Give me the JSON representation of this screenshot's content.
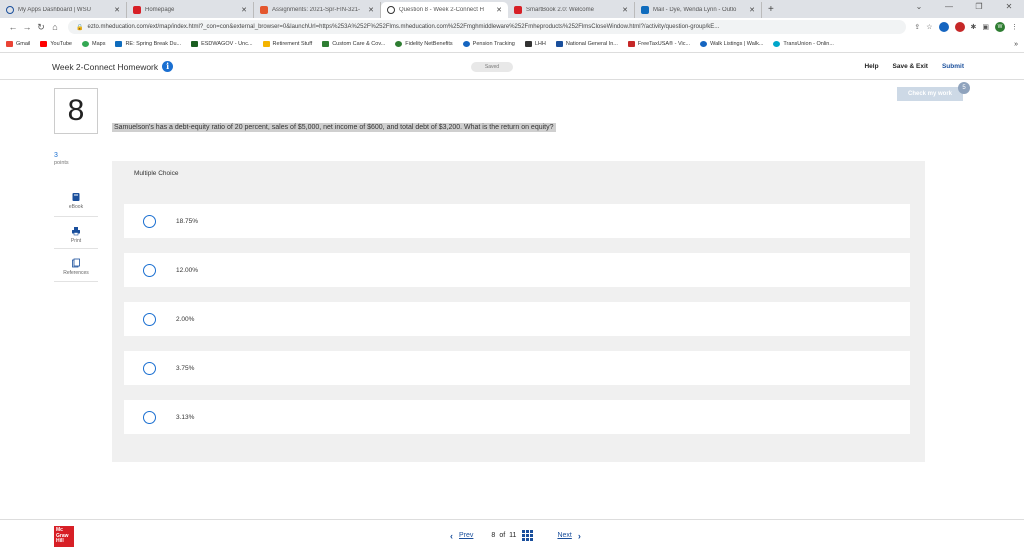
{
  "browser": {
    "tabs": [
      {
        "title": "My Apps Dashboard | WSU",
        "color": "#ffffff",
        "active": false
      },
      {
        "title": "Homepage",
        "color": "#d71f26",
        "active": false
      },
      {
        "title": "Assignments: 2021-Spr-FIN-321-",
        "color": "#e4572e",
        "active": false
      },
      {
        "title": "Question 8 - Week 2-Connect H",
        "color": "#333333",
        "active": true
      },
      {
        "title": "SmartBook 2.0: Welcome",
        "color": "#d71f26",
        "active": false
      },
      {
        "title": "Mail - Dye, Wenda Lynn - Outlo",
        "color": "#0f6cbd",
        "active": false
      }
    ],
    "new_tab": "+",
    "url": "ezto.mheducation.com/ext/map/index.html?_con=con&external_browser=0&launchUrl=https%253A%252F%252Flms.mheducation.com%252Fmghmiddleware%252Fmheproducts%252FlmsCloseWindow.html?/activity/question-group/kE...",
    "bookmarks": [
      {
        "label": "Gmail",
        "color": "#ea4335"
      },
      {
        "label": "YouTube",
        "color": "#ff0000"
      },
      {
        "label": "Maps",
        "color": "#34a853"
      },
      {
        "label": "RE: Spring Break Du...",
        "color": "#0f6cbd"
      },
      {
        "label": "ESDWAGOV - Unc...",
        "color": "#1b5e20"
      },
      {
        "label": "Retirement Stuff",
        "color": "#f4b400"
      },
      {
        "label": "Custom Care & Cov...",
        "color": "#2e7d32"
      },
      {
        "label": "Fidelity NetBenefits",
        "color": "#2e7d32"
      },
      {
        "label": "Pension Tracking",
        "color": "#1565c0"
      },
      {
        "label": "LHH",
        "color": "#333333"
      },
      {
        "label": "National General In...",
        "color": "#1a4f9c"
      },
      {
        "label": "FreeTaxUSA® - Vic...",
        "color": "#c62828"
      },
      {
        "label": "Walk Listings | Walk...",
        "color": "#1565c0"
      },
      {
        "label": "TransUnion - Onlin...",
        "color": "#00a6ca"
      }
    ],
    "bookmarks_more": "»"
  },
  "header": {
    "title": "Week 2-Connect Homework",
    "saved": "Saved",
    "help": "Help",
    "save_exit": "Save & Exit",
    "submit": "Submit"
  },
  "question": {
    "number": "8",
    "text": "Samuelson's has a debt-equity ratio of 20 percent, sales of $5,000, net income of $600, and total debt of $3,200. What is the return on equity?",
    "points_value": "3",
    "points_label": "points",
    "check_work": "Check my work",
    "check_badge": "5",
    "type_label": "Multiple Choice",
    "choices": [
      "18.75%",
      "12.00%",
      "2.00%",
      "3.75%",
      "3.13%"
    ]
  },
  "tools": {
    "ebook": "eBook",
    "print": "Print",
    "references": "References"
  },
  "footer": {
    "logo_lines": [
      "Mc",
      "Graw",
      "Hill"
    ],
    "prev": "Prev",
    "page_current": "8",
    "page_of": "of",
    "page_total": "11",
    "next": "Next"
  }
}
